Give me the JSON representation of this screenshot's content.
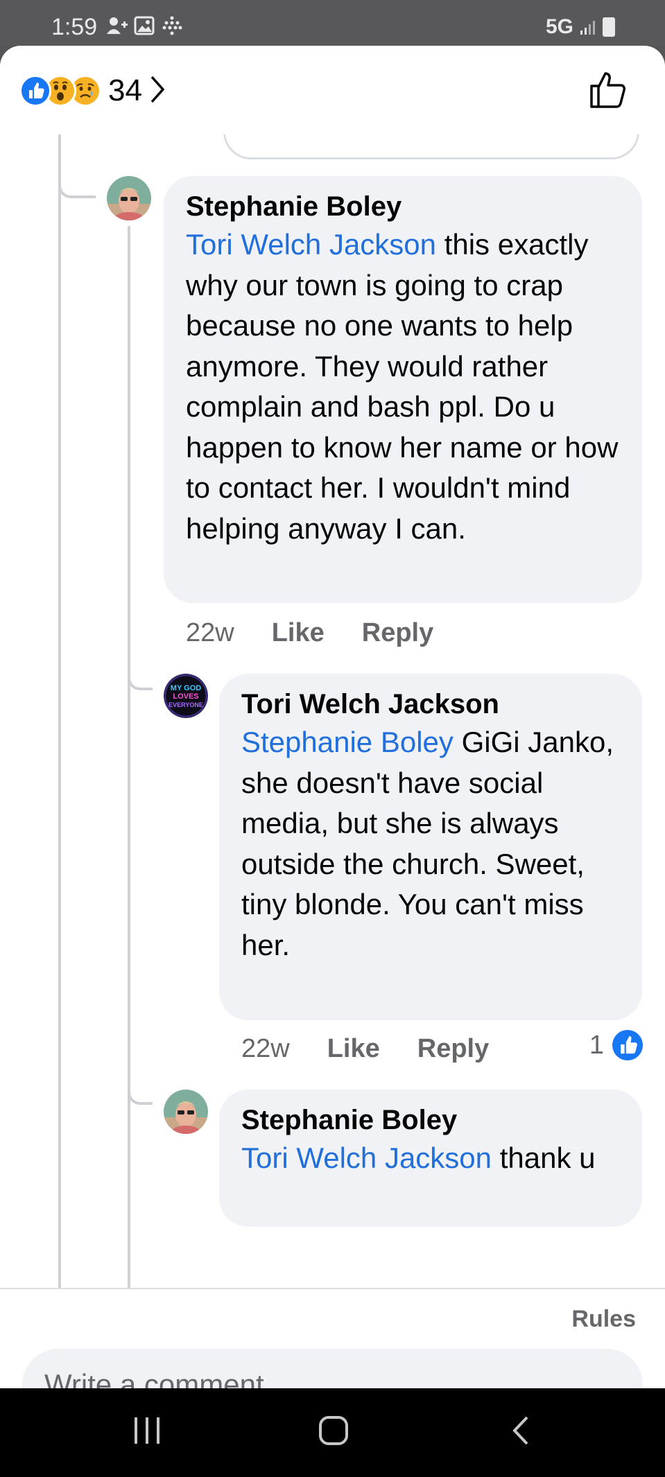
{
  "status_bar": {
    "time": "1:59",
    "network": "5G"
  },
  "header": {
    "reaction_icons": [
      "like-reaction-icon",
      "wow-reaction-icon",
      "sad-reaction-icon"
    ],
    "reaction_count": "34"
  },
  "comments": [
    {
      "author": "Stephanie Boley",
      "mention": "Tori Welch Jackson",
      "text": " this exactly why our town is going to crap because no one wants to help anymore. They would rather complain and bash ppl. Do u happen to know her name or how to contact her. I wouldn't mind helping anyway I can.",
      "time": "22w",
      "like_label": "Like",
      "reply_label": "Reply"
    },
    {
      "author": "Tori Welch Jackson",
      "mention": "Stephanie Boley",
      "text": " GiGi Janko, she doesn't have social media, but she is always outside the church. Sweet, tiny blonde. You can't miss her.",
      "time": "22w",
      "like_label": "Like",
      "reply_label": "Reply",
      "like_count": "1"
    },
    {
      "author": "Stephanie Boley",
      "mention": "Tori Welch Jackson",
      "text": " thank u"
    }
  ],
  "avatar_text": [
    "MY GOD",
    "LOVES",
    "EVERYONE"
  ],
  "footer": {
    "rules_label": "Rules",
    "input_placeholder": "Write a comment…"
  },
  "colors": {
    "accent": "#1877f2",
    "mention": "#216fdb",
    "bubble": "#f0f2f5",
    "meta_text": "#65676b"
  }
}
